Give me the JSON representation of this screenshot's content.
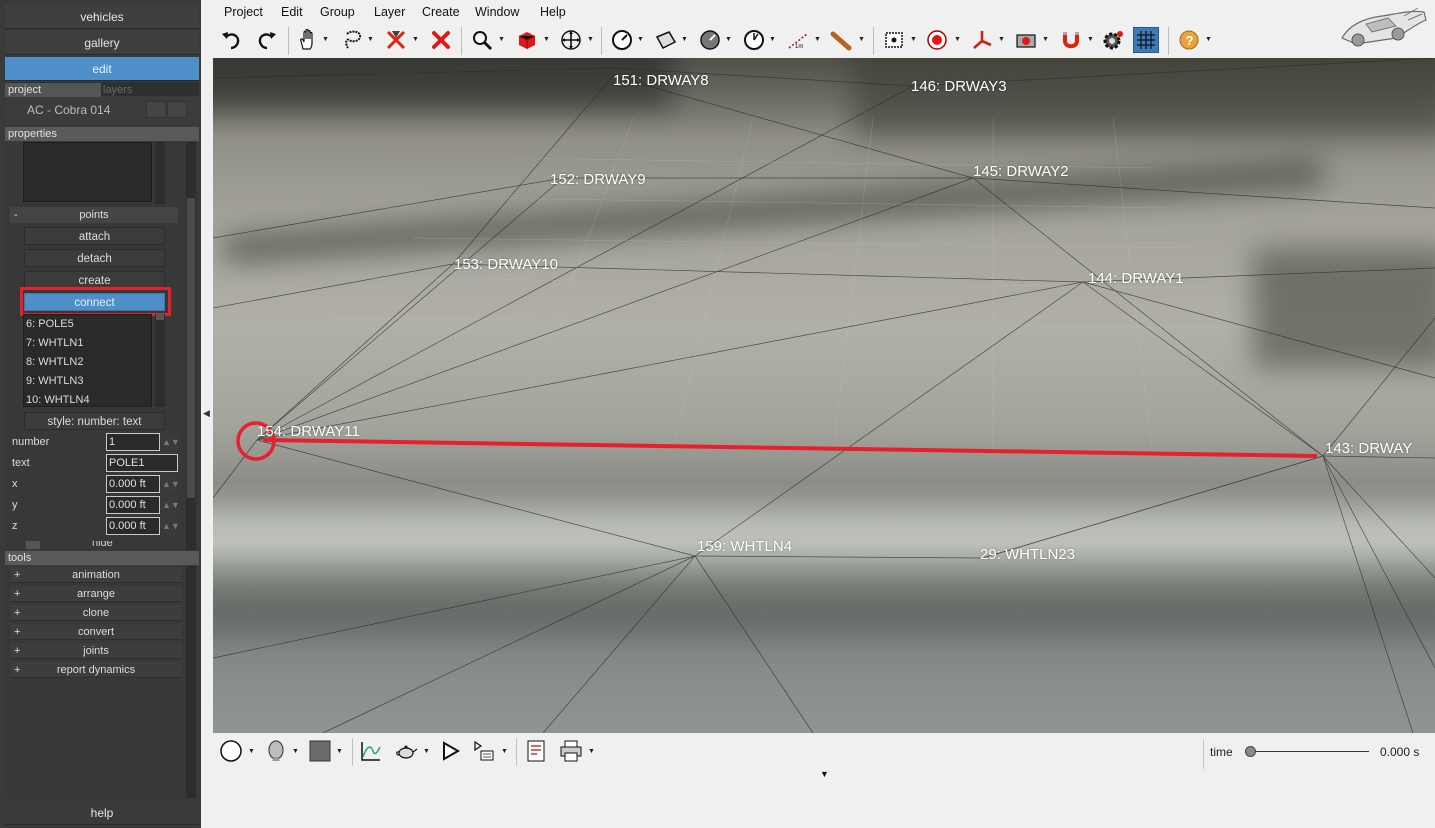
{
  "nav": {
    "vehicles": "vehicles",
    "gallery": "gallery",
    "edit": "edit"
  },
  "project_tabs": {
    "project": "project",
    "layers": "layers"
  },
  "project_name": "AC - Cobra 014",
  "properties": {
    "header": "properties",
    "points_section": {
      "toggle": "-",
      "label": "points"
    },
    "buttons": {
      "attach": "attach",
      "detach": "detach",
      "create": "create",
      "connect": "connect"
    },
    "points_list": [
      "6: POLE5",
      "7: WHTLN1",
      "8: WHTLN2",
      "9: WHTLN3",
      "10: WHTLN4"
    ],
    "style_button": "style: number: text",
    "fields": [
      {
        "label": "number",
        "value": "1"
      },
      {
        "label": "text",
        "value": "POLE1"
      },
      {
        "label": "x",
        "value": "0.000 ft"
      },
      {
        "label": "y",
        "value": "0.000 ft"
      },
      {
        "label": "z",
        "value": "0.000 ft"
      }
    ],
    "hide_label": "hide"
  },
  "tools": {
    "header": "tools",
    "items": [
      "animation",
      "arrange",
      "clone",
      "convert",
      "joints",
      "report dynamics"
    ],
    "expand_symbol": "+"
  },
  "help": "help",
  "menu": [
    "Project",
    "Edit",
    "Group",
    "Layer",
    "Create",
    "Window",
    "Help"
  ],
  "toolbar_icons": [
    "undo-icon",
    "redo-icon",
    "hand-icon",
    "lasso-icon",
    "delete-point-icon",
    "delete-icon",
    "zoom-icon",
    "red-cube-icon",
    "move-icon",
    "gauge-icon",
    "surface-icon",
    "dial-icon",
    "protractor-icon",
    "measure-icon",
    "bat-icon",
    "camera-target-icon",
    "target-icon",
    "axes-icon",
    "camera-icon",
    "magnet-icon",
    "gear-icon",
    "grid-icon",
    "help-icon"
  ],
  "accent_colors": {
    "edit_active": "#4f8fc9",
    "highlight": "#e8202a",
    "grid_active": "#3f79b8"
  },
  "node_labels": [
    "151: DRWAY8",
    "146: DRWAY3",
    "152: DRWAY9",
    "145: DRWAY2",
    "153: DRWAY10",
    "144: DRWAY1",
    "154: DRWAY11",
    "143: DRWAY",
    "159: WHTLN4",
    "29: WHTLN23"
  ],
  "timeline": {
    "label": "time",
    "value": "0.000 s"
  }
}
